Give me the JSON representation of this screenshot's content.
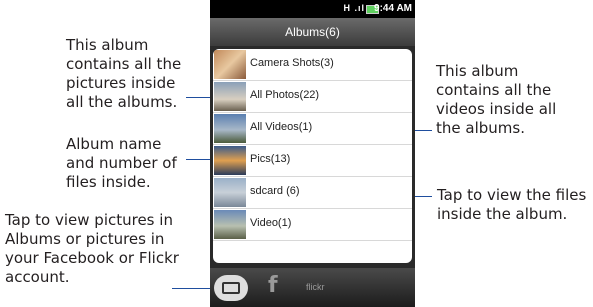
{
  "callouts": {
    "all_pictures": "This album\ncontains all the\npictures inside\nall the albums.",
    "album_name": "Album name\nand number of\nfiles inside.",
    "tap_view": "Tap to view pictures in\nAlbums or pictures in\nyour Facebook or Flickr\naccount.",
    "all_videos": "This album\ncontains all the\nvideos inside all\nthe albums.",
    "tap_files": "Tap to view the files\ninside the album."
  },
  "status_bar": {
    "time": "9:44 AM",
    "icons": "H .ıl"
  },
  "title": "Albums(6)",
  "albums": [
    {
      "label": "Camera Shots(3)"
    },
    {
      "label": "All Photos(22)"
    },
    {
      "label": "All Videos(1)"
    },
    {
      "label": "Pics(13)"
    },
    {
      "label": "sdcard (6)"
    },
    {
      "label": "Video(1)"
    }
  ],
  "tabs": {
    "facebook": "f",
    "flickr": "flickr"
  },
  "colors": {
    "leader": "#1f4e9e",
    "battery": "#5fd05f"
  }
}
